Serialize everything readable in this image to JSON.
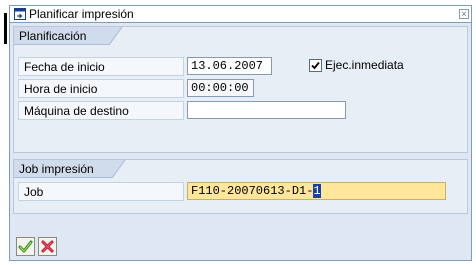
{
  "window": {
    "title": "Planificar impresión"
  },
  "planning": {
    "group_label": "Planificación",
    "start_date_label": "Fecha de inicio",
    "start_date_value": "13.06.2007",
    "immediate_label": "Ejec.inmediata",
    "immediate_checked": true,
    "start_time_label": "Hora de inicio",
    "start_time_value": "00:00:00",
    "target_machine_label": "Máquina de destino",
    "target_machine_value": ""
  },
  "print_job": {
    "group_label": "Job impresión",
    "job_label": "Job",
    "job_value_prefix": "F110-20070613-D1-",
    "job_value_cursor": "1"
  },
  "toolbar": {
    "confirm_icon": "checkmark-icon",
    "cancel_icon": "cancel-x-icon"
  },
  "colors": {
    "window_bg": "#dfe7f2",
    "focus_field": "#ffe69a",
    "confirm_green": "#2e8b1a",
    "cancel_red": "#c8102e"
  }
}
